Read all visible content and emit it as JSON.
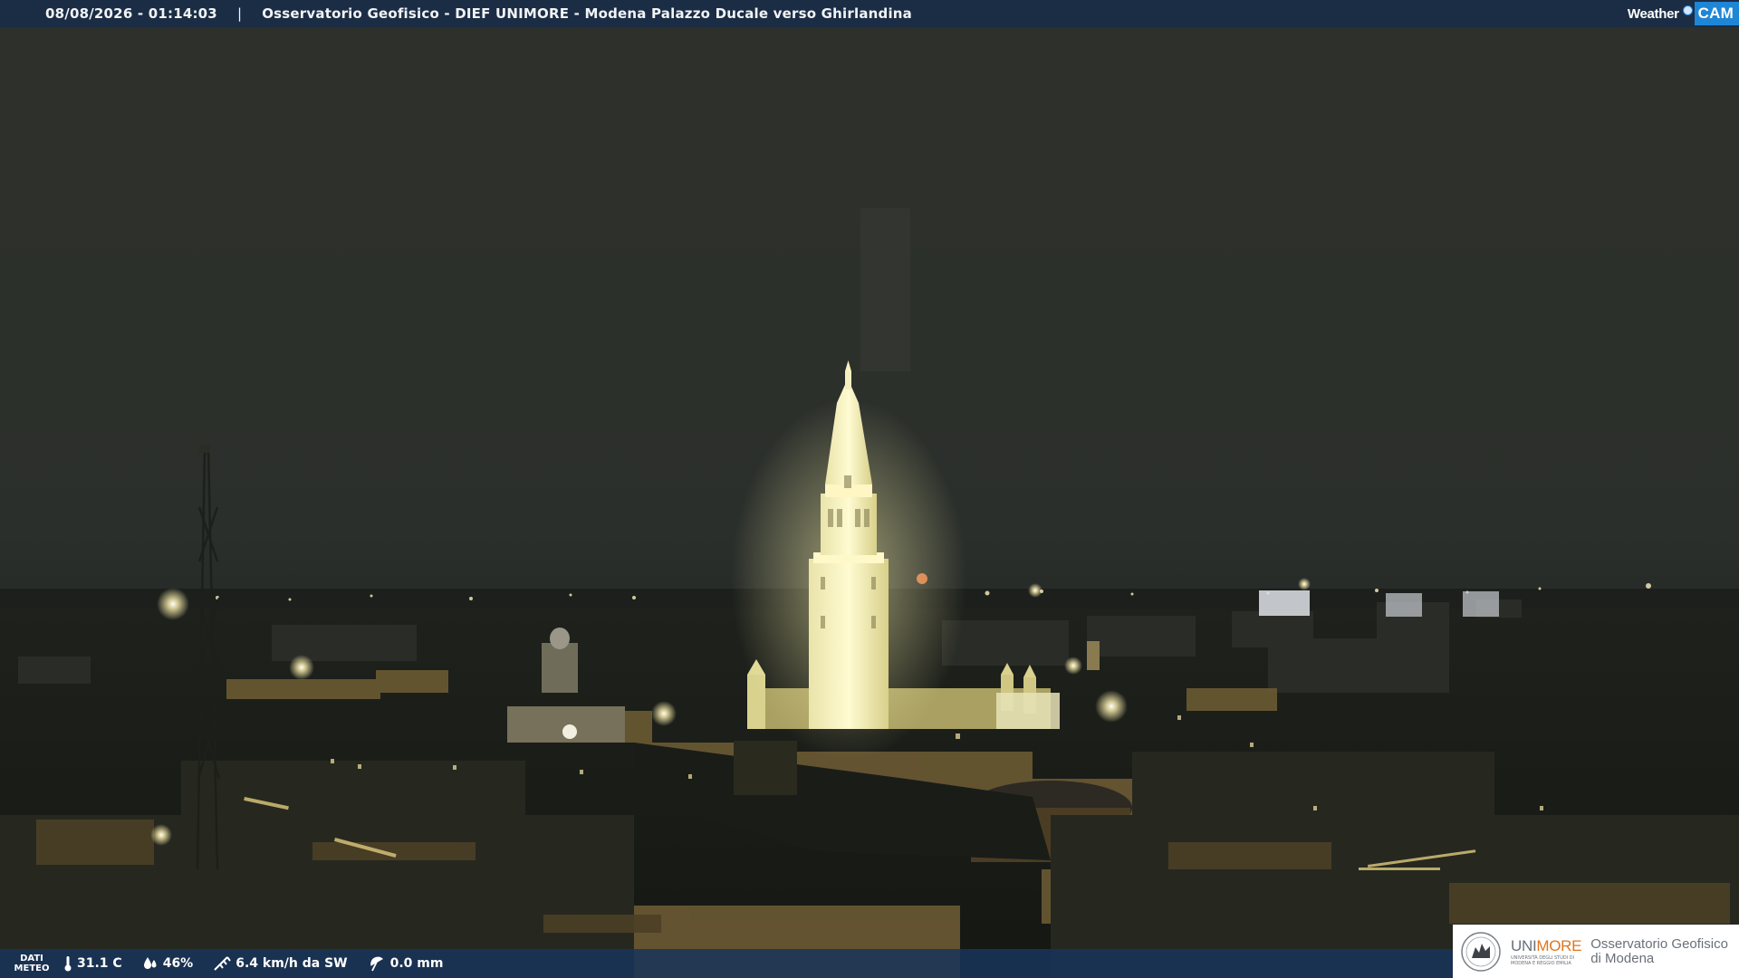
{
  "header": {
    "timestamp": "08/08/2026 - 01:14:03",
    "separator": "|",
    "caption": "Osservatorio Geofisico - DIEF UNIMORE - Modena Palazzo Ducale verso Ghirlandina",
    "brand_word": "Weather",
    "brand_cam": "CAM"
  },
  "weather": {
    "dati_line1": "DATI",
    "dati_line2": "METEO",
    "temperature": "31.1 C",
    "humidity": "46%",
    "wind": "6.4 km/h da SW",
    "rain": "0.0 mm"
  },
  "logo": {
    "unimore_a": "UNI",
    "unimore_b": "MORE",
    "unimore_sub1": "UNIVERSITÀ DEGLI STUDI DI",
    "unimore_sub2": "MODENA E REGGIO EMILIA",
    "observatory_line1": "Osservatorio Geofisico",
    "observatory_line2": "di Modena"
  },
  "colors": {
    "sky": "#2c302a",
    "tower_glow": "#fff6b8",
    "topbar": "#1b2d44",
    "brand_blue": "#1f86d6",
    "unimore_orange": "#e0751c"
  }
}
